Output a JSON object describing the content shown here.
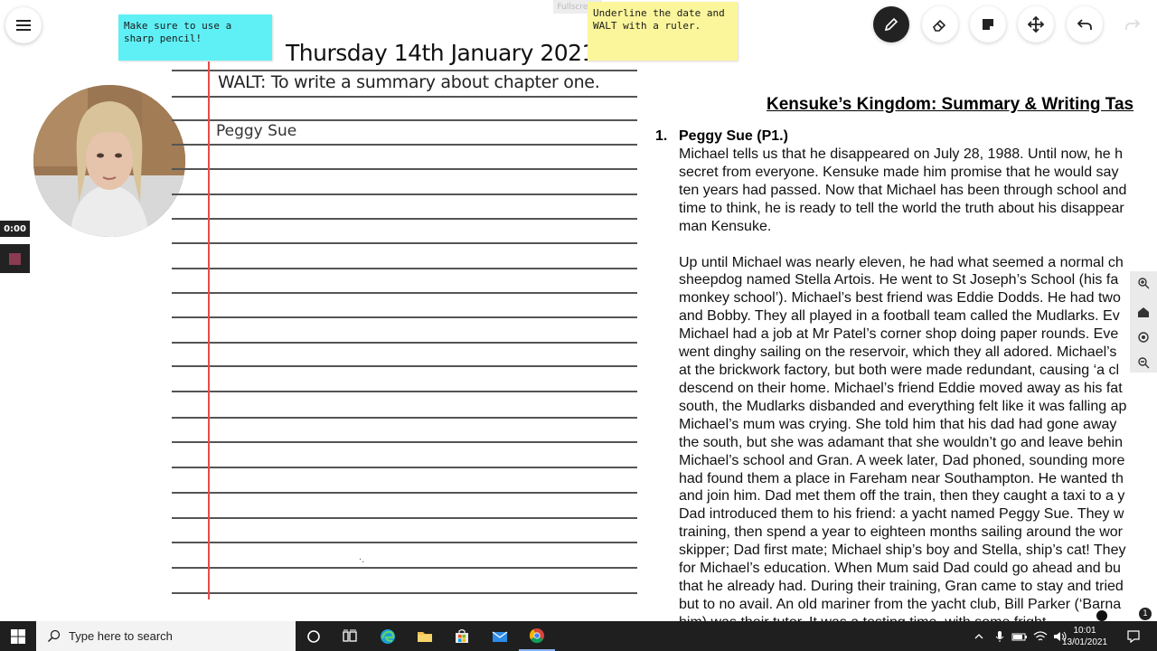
{
  "header": {
    "date_title": "Thursday 14th January 2021",
    "walt": "WALT: To write a summary about chapter one.",
    "subheading": "Peggy Sue",
    "fullscreen_label": "Fullscreen"
  },
  "sticky_notes": [
    {
      "text": "Make sure to use a sharp pencil!",
      "color": "#5ff0f5"
    },
    {
      "text": "Underline the date and WALT with a ruler.",
      "color": "#fbf69c"
    }
  ],
  "recording": {
    "timer": "0:00",
    "stop_color": "#8b3b52"
  },
  "toolbar": {
    "tools": [
      "pen-icon",
      "eraser-icon",
      "sticky-note-icon",
      "move-icon",
      "undo-icon",
      "redo-icon"
    ],
    "active": "pen-icon"
  },
  "paper": {
    "margin_color": "#e84c4c",
    "stray_mark": "·."
  },
  "document": {
    "title": "Kensuke’s Kingdom: Summary & Writing Tas",
    "section_number": "1.",
    "section_title": "Peggy Sue (P1.)",
    "lines": [
      "Michael tells us that he disappeared on July 28, 1988. Until now, he h",
      "secret from everyone.  Kensuke made him promise that he would say",
      "ten years had passed. Now that Michael has been through school and",
      "time to think, he is ready to tell the world the truth about his disappear",
      "man Kensuke.",
      "",
      "Up until Michael was nearly eleven, he had what seemed a normal ch",
      "sheepdog named Stella Artois. He went to St Joseph’s School (his fa",
      "monkey school’). Michael’s best friend was Eddie Dodds. He had two",
      "and Bobby. They all played in a football team called the Mudlarks. Ev",
      "Michael had a job at Mr Patel’s corner shop doing paper rounds. Eve",
      "went dinghy sailing on the reservoir, which they all adored. Michael’s",
      "at the brickwork factory, but both were made redundant, causing ‘a cl",
      "descend on their home. Michael’s friend Eddie moved away as his fat",
      "south, the Mudlarks disbanded and everything felt like it was falling ap",
      "Michael’s mum was crying. She told him that his dad had gone away",
      "the south, but she was adamant that she wouldn’t go and leave behin",
      "Michael’s school and Gran. A week later, Dad phoned, sounding more",
      "had found them a place in Fareham near Southampton. He wanted th",
      "and join him. Dad met them off the train, then they caught a taxi to a y",
      "Dad introduced them to his friend: a yacht named Peggy Sue. They w",
      "training, then spend a year to eighteen months sailing around the wor",
      "skipper; Dad first mate; Michael ship’s boy and Stella, ship’s cat! They",
      "for Michael’s education. When Mum said Dad could go ahead and bu",
      "that he already had. During their training, Gran came to stay and tried",
      "but to no avail. An old mariner from the yacht club, Bill Parker (‘Barna",
      "him) was their tutor. It was a testing time, with some fright"
    ]
  },
  "zoom_controls": [
    "zoom-in-icon",
    "home-icon",
    "locate-icon",
    "zoom-out-icon"
  ],
  "taskbar": {
    "search_placeholder": "Type here to search",
    "apps": [
      "cortana-icon",
      "task-view-icon",
      "edge-icon",
      "file-explorer-icon",
      "store-icon",
      "mail-icon",
      "chrome-icon"
    ],
    "time": "10:01",
    "date": "13/01/2021",
    "notification_count": "1"
  }
}
